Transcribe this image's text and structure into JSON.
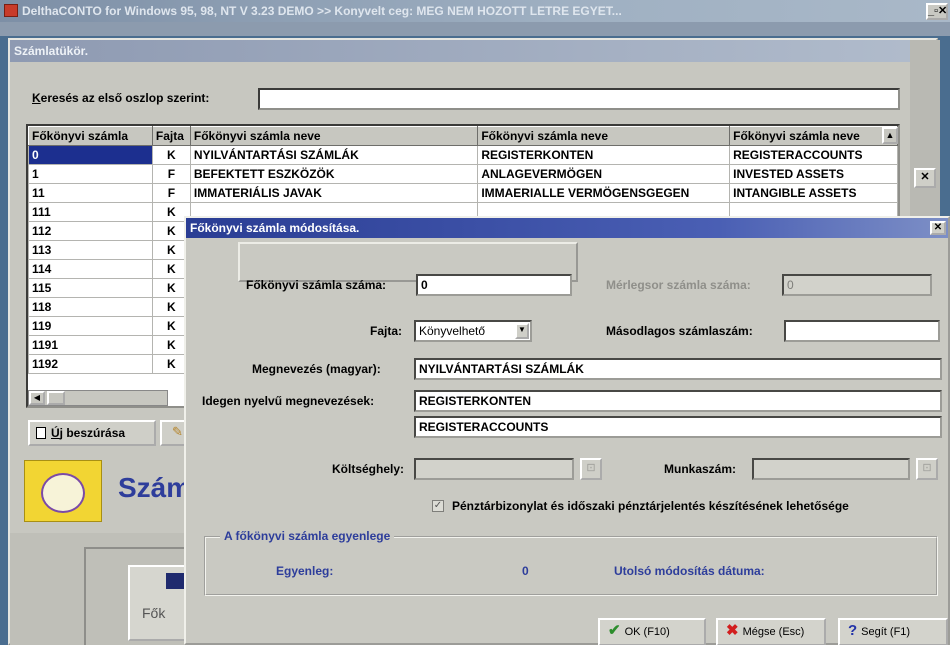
{
  "app": {
    "title": "DelthaCONTO for Windows 95, 98, NT   V 3.23 DEMO   >> Konyvelt ceg:  MEG NEM HOZOTT LETRE EGYET..."
  },
  "main_window": {
    "title": "Számlatükör.",
    "search_label_u": "K",
    "search_label_rest": "eresés az első oszlop szerint:",
    "search_value": "",
    "columns": [
      "Főkönyvi számla",
      "Fajta",
      "Főkönyvi számla neve",
      "Főkönyvi számla neve",
      "Főkönyvi számla neve"
    ],
    "rows": [
      [
        "0",
        "K",
        "NYILVÁNTARTÁSI SZÁMLÁK",
        "REGISTERKONTEN",
        "REGISTERACCOUNTS"
      ],
      [
        "1",
        "F",
        "BEFEKTETT ESZKÖZÖK",
        "ANLAGEVERMÖGEN",
        "INVESTED ASSETS"
      ],
      [
        "11",
        "F",
        "IMMATERIÁLIS JAVAK",
        "IMMAERIALLE VERMÖGENSGEGEN",
        "INTANGIBLE ASSETS"
      ],
      [
        "111",
        "K",
        "",
        "",
        ""
      ],
      [
        "112",
        "K",
        "",
        "",
        ""
      ],
      [
        "113",
        "K",
        "",
        "",
        ""
      ],
      [
        "114",
        "K",
        "",
        "",
        ""
      ],
      [
        "115",
        "K",
        "",
        "",
        ""
      ],
      [
        "118",
        "K",
        "",
        "",
        ""
      ],
      [
        "119",
        "K",
        "",
        "",
        ""
      ],
      [
        "1191",
        "K",
        "",
        "",
        ""
      ],
      [
        "1192",
        "K",
        "",
        "",
        ""
      ]
    ],
    "new_button_label_u": "Ú",
    "new_button_label_rest": "j beszúrása",
    "brand_text": "Szám",
    "tile_label": "Fők"
  },
  "dialog": {
    "title": "Főkönyvi számla módosítása.",
    "account_number_label": "Főkönyvi számla száma:",
    "account_number_value": "0",
    "balance_row_label": "Mérlegsor számla száma:",
    "balance_row_value": "0",
    "type_label": "Fajta:",
    "type_value": "Könyvelhető",
    "secondary_label": "Másodlagos számlaszám:",
    "secondary_value": "",
    "name_hu_label": "Megnevezés (magyar):",
    "name_hu_value": "NYILVÁNTARTÁSI SZÁMLÁK",
    "foreign_label": "Idegen nyelvű megnevezések:",
    "foreign_value_1": "REGISTERKONTEN",
    "foreign_value_2": "REGISTERACCOUNTS",
    "cost_center_label": "Költséghely:",
    "cost_center_value": "",
    "job_number_label": "Munkaszám:",
    "job_number_value": "",
    "checkbox_label": "Pénztárbizonylat és időszaki pénztárjelentés készítésének lehetősége",
    "checkbox_checked": true,
    "group_title": "A főkönyvi számla egyenlege",
    "balance_label": "Egyenleg:",
    "balance_value": "0",
    "last_modified_label": "Utolsó módosítás dátuma:",
    "ok_label": "OK (F10)",
    "cancel_label": "Mégse (Esc)",
    "help_label": "Segít (F1)"
  }
}
